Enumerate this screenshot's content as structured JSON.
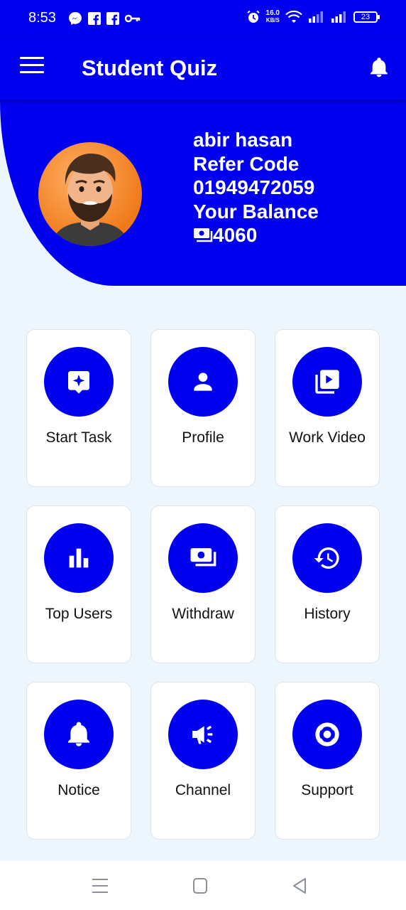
{
  "status_bar": {
    "time": "8:53",
    "speed_value": "16.0",
    "speed_unit": "KB/S",
    "battery": "23",
    "left_icons": [
      "messenger-icon",
      "facebook-icon",
      "facebook-icon",
      "key-icon"
    ],
    "right_icons": [
      "alarm-icon",
      "wifi-icon",
      "signal-icon",
      "signal-icon",
      "battery-icon"
    ]
  },
  "app_bar": {
    "title": "Student Quiz",
    "menu_icon": "menu-icon",
    "notification_icon": "bell-icon"
  },
  "profile": {
    "name": "abir hasan",
    "refer_label": "Refer Code",
    "refer_code": "01949472059",
    "balance_label": "Your Balance",
    "balance": "4060",
    "balance_icon": "money-icon"
  },
  "menu": [
    {
      "label": "Start Task",
      "icon": "task-icon"
    },
    {
      "label": "Profile",
      "icon": "person-icon"
    },
    {
      "label": "Work Video",
      "icon": "video-library-icon"
    },
    {
      "label": "Top Users",
      "icon": "bar-chart-icon"
    },
    {
      "label": "Withdraw",
      "icon": "payments-icon"
    },
    {
      "label": "History",
      "icon": "history-icon"
    },
    {
      "label": "Notice",
      "icon": "bell-icon"
    },
    {
      "label": "Channel",
      "icon": "campaign-icon"
    },
    {
      "label": "Support",
      "icon": "support-icon"
    }
  ],
  "colors": {
    "primary": "#0000EE",
    "background": "#EEF6FD",
    "card": "#FFFFFF",
    "avatar_bg": "#F07A1A"
  }
}
